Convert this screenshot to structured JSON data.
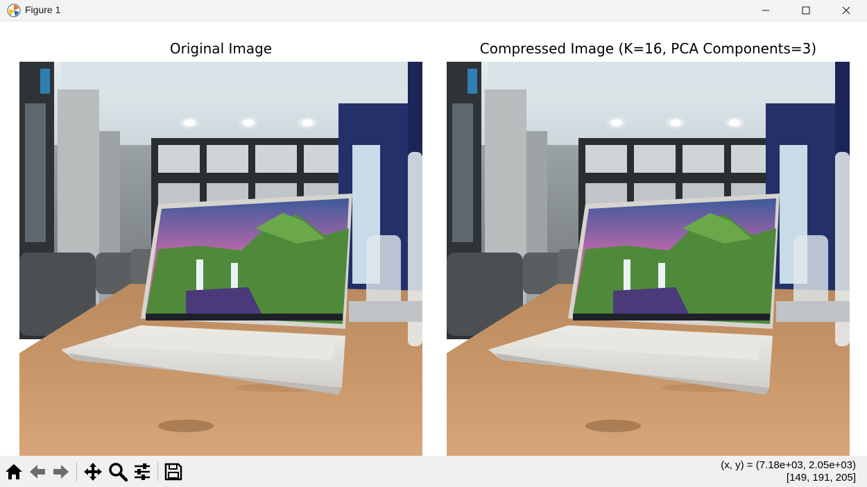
{
  "window": {
    "title": "Figure 1",
    "icon": "matplotlib-icon",
    "controls": [
      "minimize-icon",
      "maximize-icon",
      "close-icon"
    ]
  },
  "figure": {
    "axes": [
      {
        "title": "Original Image"
      },
      {
        "title": "Compressed Image (K=16, PCA Components=3)"
      }
    ]
  },
  "toolbar": {
    "buttons": [
      "home-icon",
      "back-arrow-icon",
      "forward-arrow-icon",
      "pan-icon",
      "zoom-icon",
      "configure-subplots-icon",
      "save-icon"
    ]
  },
  "status": {
    "coords": "(x, y) = (7.18e+03, 2.05e+03)",
    "pixel_value": "[149, 191, 205]"
  },
  "colors": {
    "window_bg": "#ffffff",
    "toolbar_bg": "#f0f0f0",
    "titlebar_bg": "#f3f3f3"
  }
}
